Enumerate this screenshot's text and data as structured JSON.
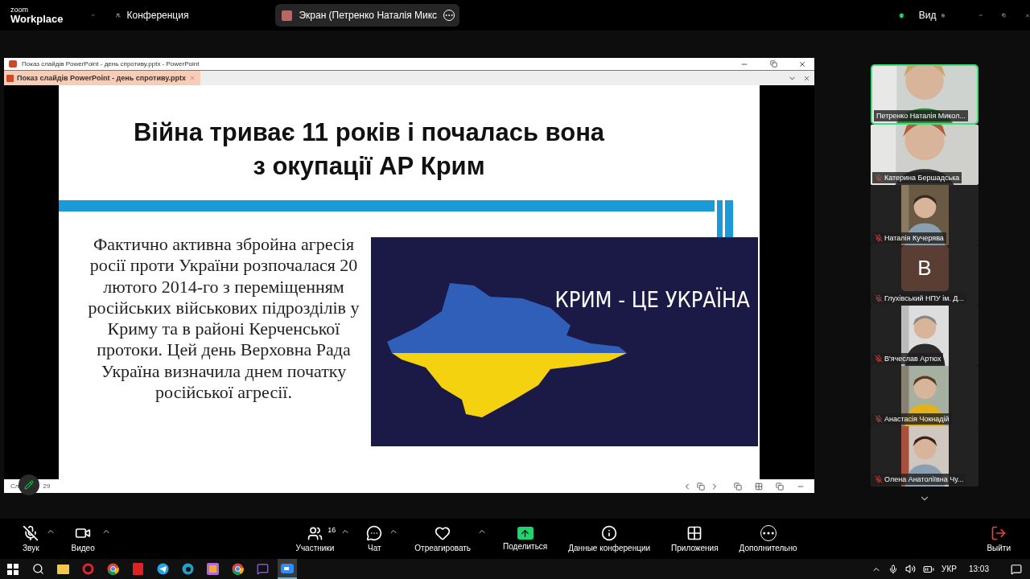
{
  "top_bar": {
    "logo_small": "zoom",
    "logo_big": "Workplace",
    "meeting_label": "Конференция",
    "share_pill": "Экран (Петренко Наталія Микс",
    "view_label": "Вид"
  },
  "shared_window": {
    "title": "Показ слайдів PowerPoint  -  день спротиву.pptx - PowerPoint",
    "tab": "Показ слайдів PowerPoint  -  день спротиву.pptx",
    "slide": {
      "title_lines": [
        "Війна триває 11 років і почалась вона",
        "з окупації АР Крим"
      ],
      "paragraph": "Фактично активна збройна агресія росії проти України розпочалася 20 лютого 2014-го з переміщенням російських військових підрозділів у Криму та в районі Керченської протоки. Цей день Верховна Рада Україна визначила днем початку російської агресії.",
      "banner": "КРИМ - ЦЕ УКРАЇНА"
    },
    "status_left": "Сл",
    "status_number": "29"
  },
  "participants": [
    {
      "name": "Петренко Наталія Микол...",
      "kind": "video",
      "speaking": true,
      "muted": false
    },
    {
      "name": "Катерина Бершадська",
      "kind": "video",
      "speaking": false,
      "muted": true
    },
    {
      "name": "Наталія Кучерява",
      "speaking": false,
      "muted": true
    },
    {
      "name": "Глухівський НПУ ім. Д...",
      "kind": "avatar",
      "letter": "B",
      "speaking": false,
      "muted": true
    },
    {
      "name": "В'ячеслав Артюх",
      "speaking": false,
      "muted": true
    },
    {
      "name": "Анастасія Чокнадій",
      "speaking": false,
      "muted": true
    },
    {
      "name": "Олена Анатоліївна Чу...",
      "speaking": false,
      "muted": true
    }
  ],
  "toolbar": [
    {
      "kind": "mic",
      "label": "Звук",
      "muted": true,
      "caret": true
    },
    {
      "kind": "video",
      "label": "Видео",
      "caret": true
    },
    {
      "kind": "spacer"
    },
    {
      "kind": "participants",
      "label": "Участники",
      "count": "16",
      "caret": true
    },
    {
      "kind": "chat",
      "label": "Чат",
      "caret": true
    },
    {
      "kind": "react",
      "label": "Отреагировать",
      "caret": true
    },
    {
      "kind": "share",
      "label": "Поделиться",
      "caret": false
    },
    {
      "kind": "info",
      "label": "Данные конференции",
      "caret": false
    },
    {
      "kind": "apps",
      "label": "Приложения",
      "caret": false
    },
    {
      "kind": "more",
      "label": "Дополнительно",
      "caret": false
    },
    {
      "kind": "spacer"
    },
    {
      "kind": "leave",
      "label": "Выйти",
      "caret": false
    }
  ],
  "taskbar": {
    "apps": [
      {
        "kind": "windows",
        "selected": false
      },
      {
        "kind": "search",
        "selected": false
      },
      {
        "kind": "folder",
        "selected": false
      },
      {
        "kind": "opera",
        "selected": false
      },
      {
        "kind": "chrome",
        "selected": false
      },
      {
        "kind": "pdf",
        "selected": false
      },
      {
        "kind": "telegram",
        "selected": false
      },
      {
        "kind": "edge",
        "selected": false
      },
      {
        "kind": "photos",
        "selected": false
      },
      {
        "kind": "chrome",
        "selected": false
      },
      {
        "kind": "viber",
        "selected": false
      },
      {
        "kind": "zoom",
        "selected": true
      }
    ],
    "language": "УКР",
    "time": "13:03"
  }
}
